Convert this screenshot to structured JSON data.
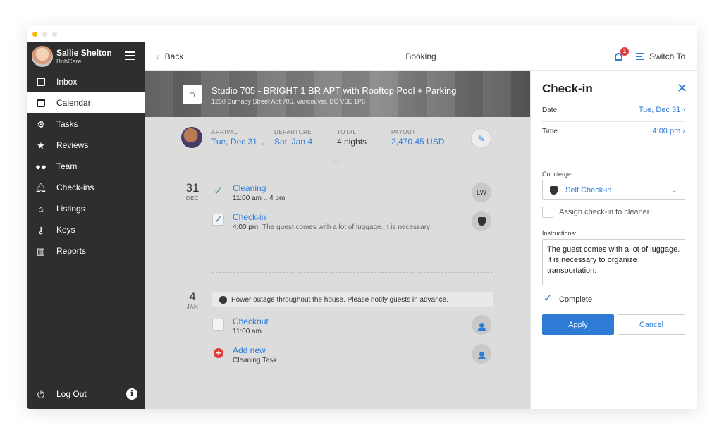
{
  "user": {
    "name": "Sallie Shelton",
    "org": "BnbCare"
  },
  "nav": {
    "items": [
      {
        "label": "Inbox",
        "icon": "inbox-icon",
        "active": false
      },
      {
        "label": "Calendar",
        "icon": "calendar-icon",
        "active": true
      },
      {
        "label": "Tasks",
        "icon": "gear-icon",
        "active": false
      },
      {
        "label": "Reviews",
        "icon": "star-icon",
        "active": false
      },
      {
        "label": "Team",
        "icon": "team-icon",
        "active": false
      },
      {
        "label": "Check-ins",
        "icon": "bell-icon",
        "active": false
      },
      {
        "label": "Listings",
        "icon": "home-icon",
        "active": false
      },
      {
        "label": "Keys",
        "icon": "key-icon",
        "active": false
      },
      {
        "label": "Reports",
        "icon": "chart-icon",
        "active": false
      }
    ],
    "logout": "Log Out"
  },
  "header": {
    "back": "Back",
    "title": "Booking",
    "notifications": "1",
    "switch": "Switch To"
  },
  "listing": {
    "title": "Studio 705 - BRIGHT 1 BR APT with Rooftop Pool + Parking",
    "address": "1250 Burnaby Street Apt 705, Vancouver, BC V6E 1P6"
  },
  "booking": {
    "arrival_label": "ARRIVAL",
    "arrival": "Tue, Dec 31",
    "departure_label": "DEPARTURE",
    "departure": "Sat, Jan 4",
    "total_label": "TOTAL",
    "total": "4 nights",
    "payout_label": "PAYOUT",
    "payout": "2,470.45 USD"
  },
  "days": [
    {
      "day": "31",
      "month": "DEC",
      "tasks": [
        {
          "title": "Cleaning",
          "time": "11:00 am .. 4 pm",
          "note": "",
          "status": "done",
          "assignee": "LW"
        },
        {
          "title": "Check-in",
          "time": "4:00 pm",
          "note": "The guest comes with a lot of luggage. It is necessary",
          "status": "checked",
          "assignee": "shield"
        }
      ]
    },
    {
      "day": "4",
      "month": "JAN",
      "alert": "Power outage throughout the house. Please notify guests in advance.",
      "tasks": [
        {
          "title": "Checkout",
          "time": "11:00 am",
          "note": "",
          "status": "unchecked",
          "assignee": "person"
        },
        {
          "title": "Add new",
          "time": "Cleaning Task",
          "note": "",
          "status": "add",
          "assignee": "person"
        }
      ]
    }
  ],
  "panel": {
    "title": "Check-in",
    "date_label": "Date",
    "date_value": "Tue, Dec 31",
    "time_label": "Time",
    "time_value": "4:00 pm",
    "concierge_label": "Concierge:",
    "concierge_value": "Self Check-in",
    "assign_label": "Assign check-in to cleaner",
    "instructions_label": "Instructions:",
    "instructions": "The guest comes with a lot of luggage. It is necessary to organize transportation.",
    "complete_label": "Complete",
    "apply": "Apply",
    "cancel": "Cancel"
  },
  "colors": {
    "accent": "#2e7bd6",
    "sidebar": "#2e2e2e",
    "success": "#3fa04b",
    "danger": "#e03b3b"
  }
}
